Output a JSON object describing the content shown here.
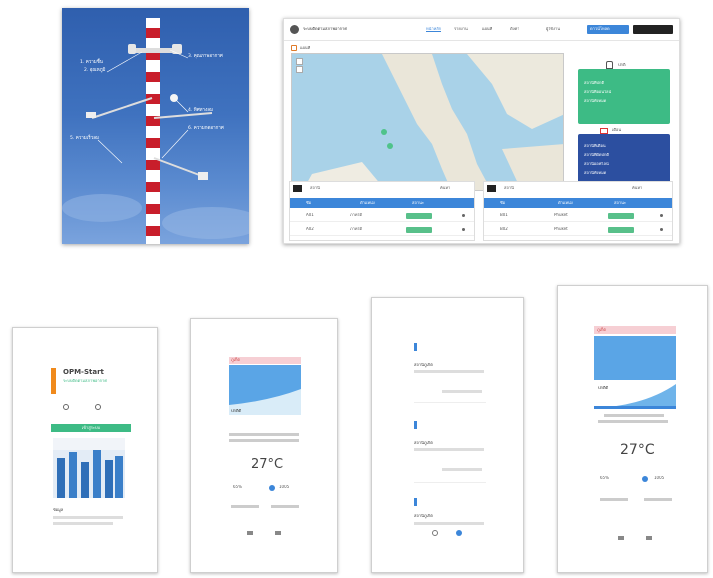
{
  "photo": {
    "callouts": [
      "1. ความชื้น",
      "2. อุณหภูมิ",
      "3. คุณภาพอากาศ",
      "4. ทิศทางลม",
      "5. ความเร็วลม",
      "6. ความกดอากาศ"
    ]
  },
  "dashboard": {
    "brand": "ระบบติดตามสภาพอากาศ",
    "nav_items": [
      "หน้าหลัก",
      "รายงาน",
      "แผนที่",
      "ตั้งค่า",
      "ผู้ใช้งาน"
    ],
    "nav_button": "ดาวน์โหลด",
    "map_label": "แผนที่",
    "card_green": {
      "title": "ปกติ",
      "rows": [
        "สถานีที่ปกติ",
        "สถานีที่ออนไลน์",
        "สถานีทั้งหมด"
      ]
    },
    "card_blue": {
      "title": "เตือน",
      "rows": [
        "สถานีที่เตือน",
        "สถานีที่ผิดปกติ",
        "สถานีออฟไลน์",
        "สถานีทั้งหมด"
      ]
    },
    "table_left": {
      "title": "สถานี",
      "action": "ค้นหา",
      "headers": [
        "ชื่อ",
        "ตำแหน่ง",
        "สถานะ"
      ],
      "rows": [
        [
          "A01",
          "ภาคใต้"
        ],
        [
          "A02",
          "ภาคใต้"
        ]
      ]
    },
    "table_right": {
      "title": "สถานี",
      "action": "ค้นหา",
      "headers": [
        "ชื่อ",
        "ตำแหน่ง",
        "สถานะ"
      ],
      "rows": [
        [
          "B01",
          "Phuket"
        ],
        [
          "B02",
          "Phuket"
        ]
      ]
    }
  },
  "phones": {
    "p1": {
      "title": "OPM-Start",
      "subtitle": "ระบบติดตามสภาพอากาศ",
      "button": "เข้าสู่ระบบ",
      "caption": "ข้อมูล"
    },
    "p2": {
      "header": "ภูเก็ต",
      "label": "ปกติดี",
      "temp": "27°C",
      "stats": [
        "65%",
        "1005"
      ]
    },
    "p3": {
      "items": [
        "สถานีภูเก็ต",
        "สถานีภูเก็ต",
        "สถานีภูเก็ต"
      ]
    },
    "p4": {
      "header": "ภูเก็ต",
      "label": "ปกติดี",
      "temp": "27°C",
      "stats": [
        "65%",
        "1005"
      ]
    }
  },
  "colors": {
    "accent_blue": "#3c86d9",
    "green": "#3dbb85",
    "navy": "#2c4fa0",
    "orange": "#f08a1c",
    "pink": "#f6cfd4"
  }
}
